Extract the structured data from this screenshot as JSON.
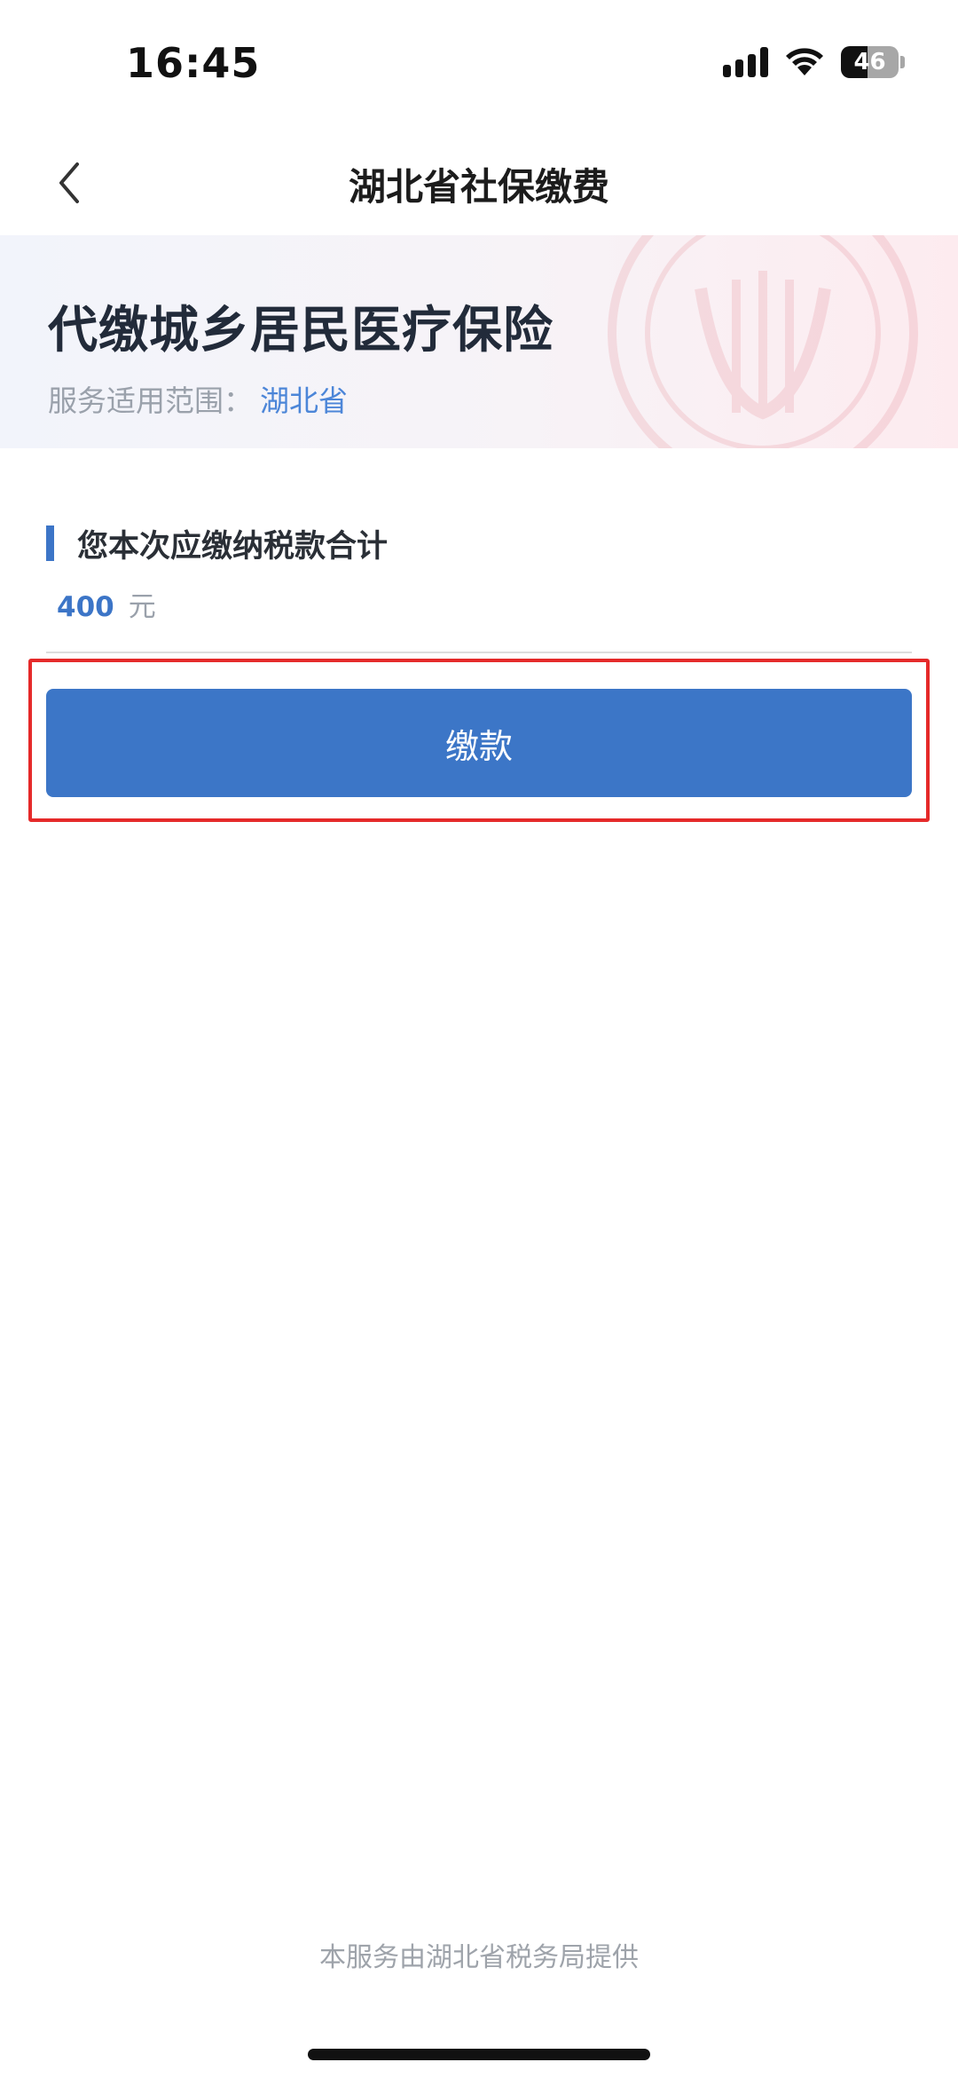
{
  "status_bar": {
    "time": "16:45",
    "battery": "46"
  },
  "nav": {
    "title": "湖北省社保缴费"
  },
  "banner": {
    "title": "代缴城乡居民医疗保险",
    "scope_label": "服务适用范围：",
    "scope_value": "湖北省"
  },
  "amount": {
    "label": "您本次应缴纳税款合计",
    "value": "400",
    "unit": "元"
  },
  "actions": {
    "pay_label": "缴款"
  },
  "footer": {
    "text": "本服务由湖北省税务局提供"
  },
  "colors": {
    "accent": "#3c76c7",
    "highlight": "#e52a2a",
    "scope_value": "#4c86d8"
  }
}
